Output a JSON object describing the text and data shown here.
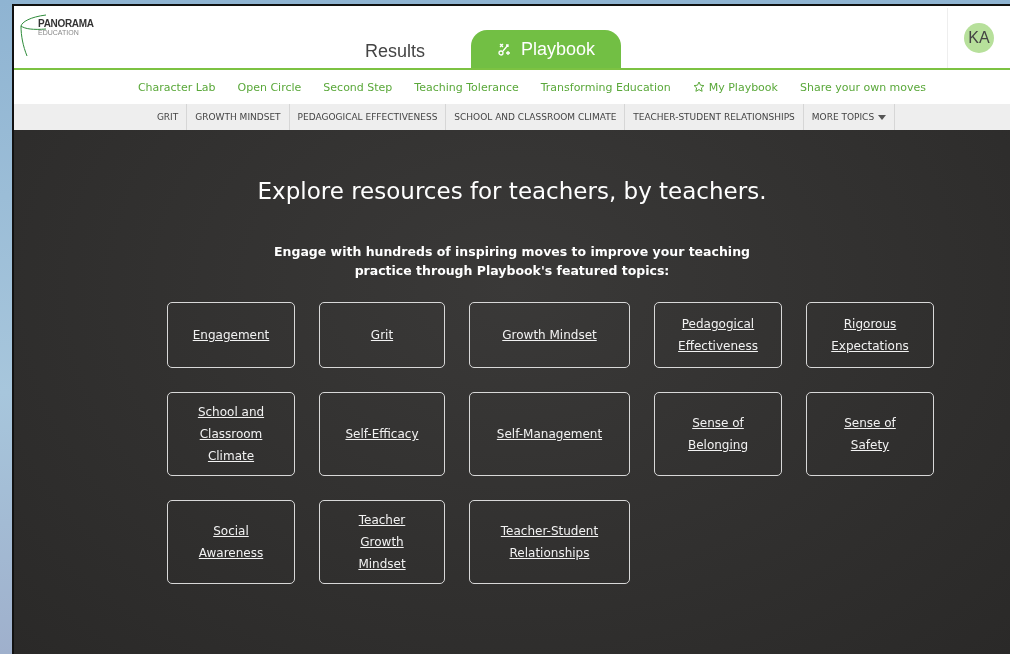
{
  "logo": {
    "name": "PANORAMA",
    "subtitle": "EDUCATION"
  },
  "tabs": [
    {
      "label": "Results",
      "selected": false,
      "kind": "plain"
    },
    {
      "label": "Playbook",
      "selected": true,
      "kind": "icon"
    }
  ],
  "user": {
    "initials": "KA"
  },
  "partner_links": [
    {
      "label": "Character Lab",
      "kind": "plain"
    },
    {
      "label": "Open Circle",
      "kind": "plain"
    },
    {
      "label": "Second Step",
      "kind": "plain"
    },
    {
      "label": "Teaching Tolerance",
      "kind": "plain"
    },
    {
      "label": "Transforming Education",
      "kind": "plain"
    },
    {
      "label": "My Playbook",
      "kind": "star"
    },
    {
      "label": "Share your own moves",
      "kind": "plain"
    }
  ],
  "topics_bar": [
    {
      "label": "GRIT",
      "kind": "plain"
    },
    {
      "label": "GROWTH MINDSET",
      "kind": "plain"
    },
    {
      "label": "PEDAGOGICAL EFFECTIVENESS",
      "kind": "plain"
    },
    {
      "label": "SCHOOL AND CLASSROOM CLIMATE",
      "kind": "plain"
    },
    {
      "label": "TEACHER-STUDENT RELATIONSHIPS",
      "kind": "plain"
    },
    {
      "label": "MORE TOPICS",
      "kind": "dropdown"
    }
  ],
  "hero": {
    "title": "Explore resources for teachers, by teachers.",
    "subtitle": "Engage with hundreds of inspiring moves to improve your teaching practice through Playbook's featured topics:"
  },
  "featured_topics": [
    [
      {
        "label": "Engagement"
      },
      {
        "label": "Grit"
      },
      {
        "label": "Growth Mindset"
      },
      {
        "label": "Pedagogical Effectiveness"
      },
      {
        "label": "Rigorous Expectations"
      }
    ],
    [
      {
        "label": "School and Classroom Climate"
      },
      {
        "label": "Self-Efficacy"
      },
      {
        "label": "Self-Management"
      },
      {
        "label": "Sense of Belonging"
      },
      {
        "label": "Sense of Safety"
      }
    ],
    [
      {
        "label": "Social Awareness"
      },
      {
        "label": "Teacher Growth Mindset"
      },
      {
        "label": "Teacher-Student Relationships"
      }
    ]
  ]
}
